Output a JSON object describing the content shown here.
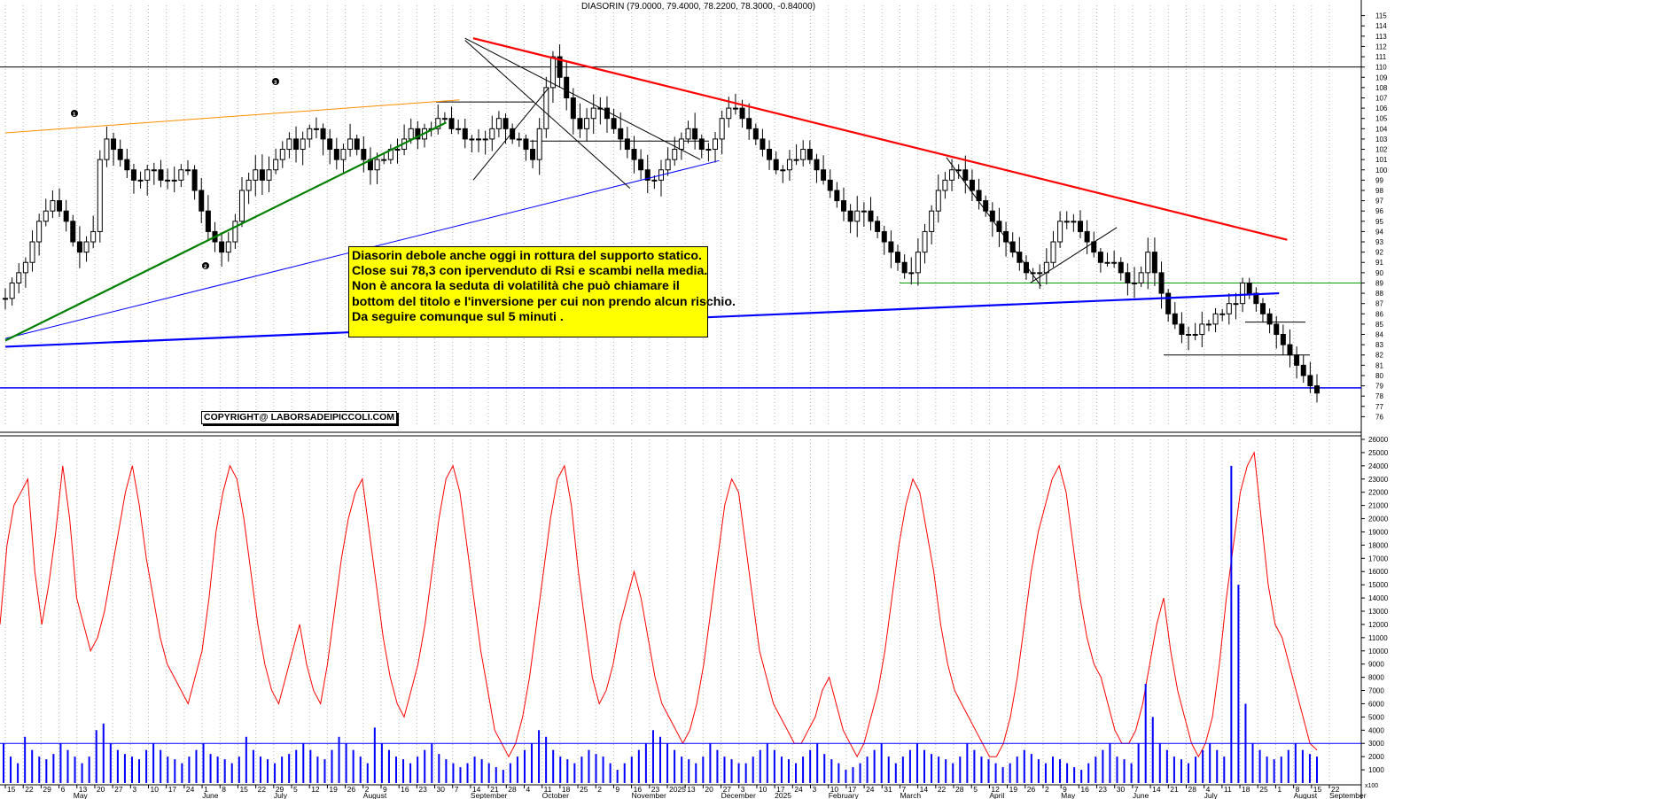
{
  "chart_data": [
    {
      "type": "candlestick",
      "title": "DIASORIN (79.0000, 79.4000, 78.2200, 78.3000, -0.84000)",
      "y_axis": {
        "position": "right",
        "ylim": [
          75,
          116
        ],
        "tick_labels": [
          "76",
          "77",
          "78",
          "79",
          "80",
          "81",
          "82",
          "83",
          "84",
          "85",
          "86",
          "87",
          "88",
          "89",
          "90",
          "91",
          "92",
          "93",
          "94",
          "95",
          "96",
          "97",
          "98",
          "99",
          "100",
          "101",
          "102",
          "103",
          "104",
          "105",
          "106",
          "107",
          "108",
          "109",
          "110",
          "111",
          "112",
          "113",
          "114",
          "115"
        ]
      },
      "x_axis": {
        "day_labels": [
          "15",
          "22",
          "29",
          "6",
          "13",
          "20",
          "27",
          "3",
          "10",
          "17",
          "24",
          "1",
          "8",
          "15",
          "22",
          "29",
          "5",
          "12",
          "19",
          "26",
          "2",
          "9",
          "16",
          "23",
          "30",
          "7",
          "14",
          "21",
          "28",
          "4",
          "11",
          "18",
          "25",
          "2",
          "9",
          "16",
          "23",
          "2025",
          "13",
          "20",
          "27",
          "3",
          "10",
          "17",
          "24",
          "3",
          "10",
          "17",
          "24",
          "31",
          "7",
          "14",
          "22",
          "28",
          "5",
          "12",
          "19",
          "26",
          "2",
          "9",
          "16",
          "23",
          "30",
          "7",
          "14",
          "21",
          "28",
          "4",
          "11",
          "18",
          "25",
          "1",
          "8",
          "15",
          "22"
        ],
        "month_labels": [
          "May",
          "June",
          "July",
          "August",
          "September",
          "October",
          "November",
          "December",
          "2025",
          "February",
          "March",
          "April",
          "May",
          "June",
          "July",
          "August",
          "September"
        ]
      },
      "series": [
        {
          "name": "",
          "kind": "close",
          "color": "#000000",
          "values": [
            87.5,
            89,
            90,
            91,
            93,
            95,
            96,
            97,
            96,
            95,
            93,
            92,
            93,
            94,
            101,
            103,
            102,
            101,
            100,
            99,
            99,
            100,
            100,
            99,
            99,
            99,
            100,
            100,
            98,
            96,
            94,
            93,
            92,
            93,
            95,
            98,
            99,
            100,
            99,
            100,
            101,
            102,
            103,
            102,
            103,
            104,
            104,
            103,
            102,
            101,
            102,
            103,
            102,
            101,
            100,
            101,
            101,
            102,
            102,
            103,
            104,
            103,
            104,
            104,
            105,
            105,
            104,
            104,
            103,
            103,
            103,
            103,
            104,
            105,
            104,
            103,
            103,
            102,
            101,
            104,
            108,
            111,
            109,
            107,
            105,
            104,
            105,
            106,
            106,
            105,
            104,
            103,
            102,
            101,
            100,
            99,
            99,
            100,
            101,
            102,
            103,
            104,
            103,
            102,
            102,
            103,
            105,
            106,
            106,
            105,
            104,
            103,
            102,
            101,
            100,
            100,
            101,
            101,
            102,
            101,
            100,
            99,
            98,
            97,
            96,
            95,
            96,
            96,
            95,
            94,
            93,
            92,
            91,
            90,
            90,
            92,
            94,
            96,
            98,
            99,
            100,
            100,
            99,
            98,
            97,
            96,
            95,
            94,
            93,
            92,
            91,
            90,
            90,
            90,
            91,
            93,
            95,
            95,
            95,
            94,
            93,
            92,
            91,
            91,
            91,
            90,
            89,
            89,
            90,
            92,
            90,
            88,
            86,
            85,
            84,
            84,
            84,
            85,
            85,
            86,
            86,
            87,
            87,
            89,
            88,
            87,
            86,
            85,
            84,
            83,
            82,
            81,
            80,
            79,
            78.3
          ]
        },
        {
          "name": "",
          "kind": "volume-oscillator",
          "color": "#ff0000",
          "values": [
            12000,
            18000,
            21000,
            22000,
            23000,
            16000,
            12000,
            15000,
            19000,
            24000,
            20000,
            14000,
            12000,
            10000,
            11000,
            13000,
            16000,
            19000,
            22000,
            24000,
            21000,
            17000,
            14000,
            11000,
            9000,
            8000,
            7000,
            6000,
            8000,
            10000,
            14000,
            19000,
            22000,
            24000,
            23000,
            20000,
            16000,
            12000,
            9000,
            7000,
            6000,
            8000,
            10000,
            12000,
            9000,
            7000,
            6000,
            9000,
            13000,
            17000,
            20000,
            22000,
            23000,
            19000,
            15000,
            11000,
            8000,
            6000,
            5000,
            7000,
            9000,
            12000,
            16000,
            20000,
            23000,
            24000,
            22000,
            18000,
            14000,
            10000,
            7000,
            4000,
            3000,
            2000,
            3000,
            5000,
            8000,
            12000,
            16000,
            20000,
            23000,
            24000,
            21000,
            16000,
            12000,
            8000,
            6000,
            7000,
            9000,
            12000,
            14000,
            16000,
            14000,
            11000,
            8000,
            6000,
            5000,
            4000,
            3000,
            4000,
            6000,
            9000,
            13000,
            17000,
            21000,
            23000,
            22000,
            18000,
            14000,
            10000,
            8000,
            6000,
            5000,
            4000,
            3000,
            3000,
            4000,
            5000,
            7000,
            8000,
            6000,
            4000,
            3000,
            2000,
            3000,
            5000,
            7000,
            10000,
            14000,
            18000,
            21000,
            23000,
            22000,
            19000,
            16000,
            12000,
            9000,
            7000,
            6000,
            5000,
            4000,
            3000,
            2000,
            2000,
            3000,
            5000,
            8000,
            12000,
            16000,
            19000,
            21000,
            23000,
            24000,
            22000,
            18000,
            14000,
            11000,
            9000,
            8000,
            6000,
            4000,
            3000,
            3000,
            4000,
            6000,
            9000,
            12000,
            14000,
            10000,
            7000,
            5000,
            3000,
            2000,
            3000,
            5000,
            9000,
            14000,
            18000,
            22000,
            24000,
            25000,
            20000,
            15000,
            12000,
            11000,
            9000,
            7000,
            5000,
            3000,
            2500
          ]
        },
        {
          "name": "",
          "kind": "volume",
          "color": "#0000ff",
          "values": [
            3000,
            2000,
            1500,
            3500,
            2500,
            2000,
            1800,
            2200,
            3000,
            2500,
            2000,
            1500,
            2000,
            4000,
            4500,
            3000,
            2500,
            2200,
            2000,
            1800,
            2500,
            3000,
            2500,
            2000,
            1800,
            1500,
            2000,
            2500,
            3000,
            2200,
            2000,
            1800,
            1500,
            2000,
            3500,
            2500,
            2000,
            1800,
            1500,
            2000,
            2200,
            2500,
            3000,
            2500,
            2000,
            1800,
            2500,
            3500,
            3000,
            2500,
            2000,
            1500,
            4200,
            3000,
            2500,
            2000,
            1800,
            1500,
            2000,
            2500,
            3000,
            2200,
            1800,
            1500,
            1200,
            1500,
            2000,
            1800,
            1500,
            1200,
            1000,
            1500,
            2000,
            2500,
            3000,
            4000,
            3500,
            2500,
            2000,
            1800,
            1500,
            2000,
            2500,
            2200,
            2000,
            1500,
            1000,
            1500,
            2000,
            2500,
            3000,
            4000,
            3500,
            3000,
            2500,
            2000,
            1800,
            1500,
            2000,
            3000,
            2500,
            2000,
            1800,
            1500,
            1500,
            2000,
            2500,
            3000,
            2500,
            2000,
            1800,
            1500,
            2000,
            2500,
            3000,
            2200,
            1800,
            1500,
            1000,
            1200,
            1500,
            2000,
            2500,
            3000,
            2000,
            1500,
            2000,
            2500,
            3000,
            2500,
            2200,
            2000,
            1800,
            1500,
            2000,
            3000,
            2500,
            2000,
            1800,
            1500,
            1200,
            1500,
            2000,
            2500,
            2200,
            1800,
            1500,
            2000,
            1800,
            1500,
            1200,
            1000,
            1500,
            2000,
            2500,
            3000,
            2000,
            1800,
            1500,
            3000,
            7500,
            5000,
            3000,
            2500,
            2000,
            1800,
            1500,
            2000,
            2500,
            3000,
            2500,
            2000,
            24000,
            15000,
            6000,
            3000,
            2500,
            2000,
            1800,
            2000,
            2500,
            3000,
            2500,
            2200,
            2000
          ]
        }
      ],
      "trendlines": [
        {
          "color": "#ff0000",
          "from": [
            "2024-11-04",
            112.8
          ],
          "to": [
            "2025-09-01",
            93.2
          ]
        },
        {
          "color": "#0000ff",
          "from": [
            "2024-05-15",
            82.8
          ],
          "to": [
            "2025-08-29",
            88.0
          ]
        },
        {
          "color": "#0000ff",
          "from": [
            "2024-05-15",
            83.6
          ],
          "to": [
            "2025-02-03",
            100.9
          ]
        },
        {
          "color": "#008000",
          "from": [
            "2024-05-15",
            83.4
          ],
          "to": [
            "2024-10-25",
            104.6
          ]
        },
        {
          "color": "#ff8c00",
          "from": [
            "2024-05-15",
            103.6
          ],
          "to": [
            "2024-10-30",
            106.8
          ]
        },
        {
          "color": "#000000",
          "from": [
            "2024-11-01",
            112.6
          ],
          "to": [
            "2025-01-01",
            98.2
          ]
        },
        {
          "color": "#000000",
          "from": [
            "2024-11-01",
            112.8
          ],
          "to": [
            "2025-01-27",
            101.0
          ]
        },
        {
          "color": "#000000",
          "from": [
            "2024-11-04",
            99.0
          ],
          "to": [
            "2024-12-02",
            108.0
          ]
        },
        {
          "color": "#000000",
          "from": [
            "2025-04-28",
            101.2
          ],
          "to": [
            "2025-06-02",
            88.7
          ]
        },
        {
          "color": "#000000",
          "from": [
            "2025-05-29",
            89.0
          ],
          "to": [
            "2025-06-30",
            94.4
          ]
        }
      ],
      "horizontal_levels": [
        {
          "value": 110,
          "color": "#000000"
        },
        {
          "value": 89,
          "color": "#00a000"
        },
        {
          "value": 82,
          "color": "#000000"
        },
        {
          "value": 85.2,
          "color": "#000000"
        },
        {
          "value": 106.6,
          "color": "#000000"
        },
        {
          "value": 102.8,
          "color": "#000000"
        },
        {
          "value": 78.8,
          "color": "#0000ff"
        }
      ],
      "wave_markers": [
        "1",
        "2",
        "3"
      ],
      "annotation": {
        "lines": [
          "Diasorin debole anche oggi in rottura del supporto statico.",
          "Close sui 78,3  con ipervenduto di Rsi e scambi nella media.",
          "Non è ancora la seduta di volatilità che può chiamare il",
          "bottom del titolo e l'inversione per cui non prendo alcun rischio.",
          "Da seguire comunque sul 5 minuti ."
        ],
        "background": "#ffff00"
      },
      "copyright": "COPYRIGHT@ LABORSADEIPICCOLI.COM",
      "grid": true
    },
    {
      "type": "volume",
      "y_axis": {
        "position": "right",
        "ylim": [
          0,
          26000
        ],
        "tick_labels": [
          "1000",
          "2000",
          "3000",
          "4000",
          "5000",
          "6000",
          "7000",
          "8000",
          "9000",
          "10000",
          "11000",
          "12000",
          "13000",
          "14000",
          "15000",
          "16000",
          "17000",
          "18000",
          "19000",
          "20000",
          "21000",
          "22000",
          "23000",
          "24000",
          "25000",
          "26000"
        ],
        "unit_label": "x100"
      },
      "reference_level": 3000,
      "grid": true
    }
  ],
  "colors": {
    "background": "#ffffff",
    "grid": "#b4b4b4",
    "candle": "#000000",
    "resistance": "#ff0000",
    "support_blue": "#0000ff",
    "support_green": "#008000",
    "upper_trend": "#ff8c00",
    "oscillator": "#ff0000",
    "volume": "#0000ff"
  }
}
